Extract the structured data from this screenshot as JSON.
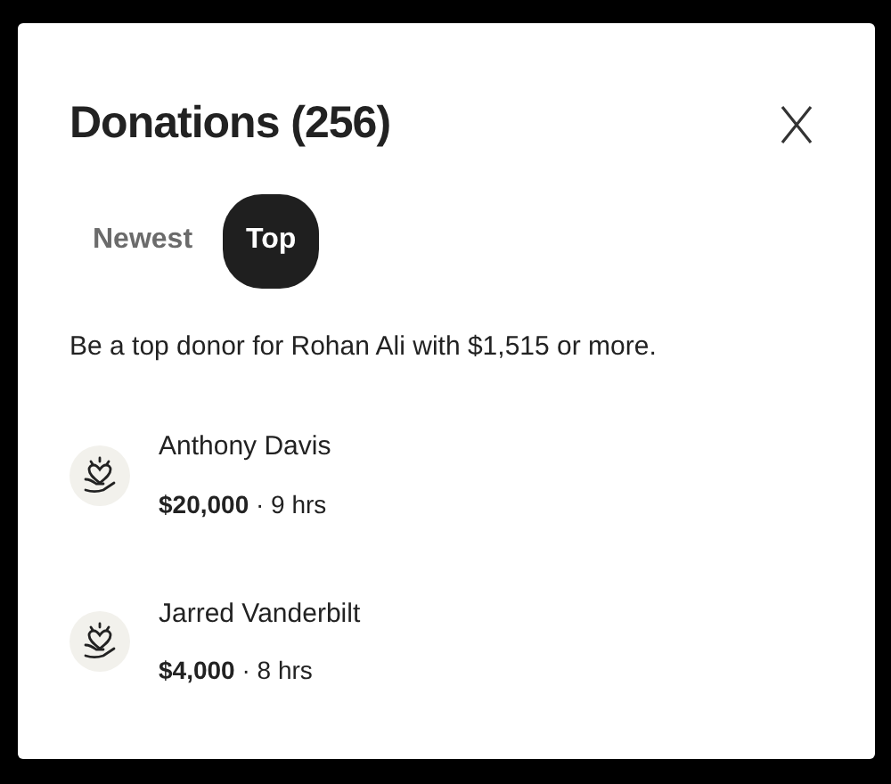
{
  "dialog": {
    "title": "Donations (256)"
  },
  "tabs": [
    {
      "label": "Newest",
      "selected": false
    },
    {
      "label": "Top",
      "selected": true
    }
  ],
  "description": "Be a top donor for Rohan Ali with $1,515 or more.",
  "donations": [
    {
      "name": "Anthony Davis",
      "detail": "**$20,000** · 9 hrs"
    },
    {
      "name": "Jarred Vanderbilt",
      "detail": "**$4,000** · 8 hrs"
    }
  ]
}
